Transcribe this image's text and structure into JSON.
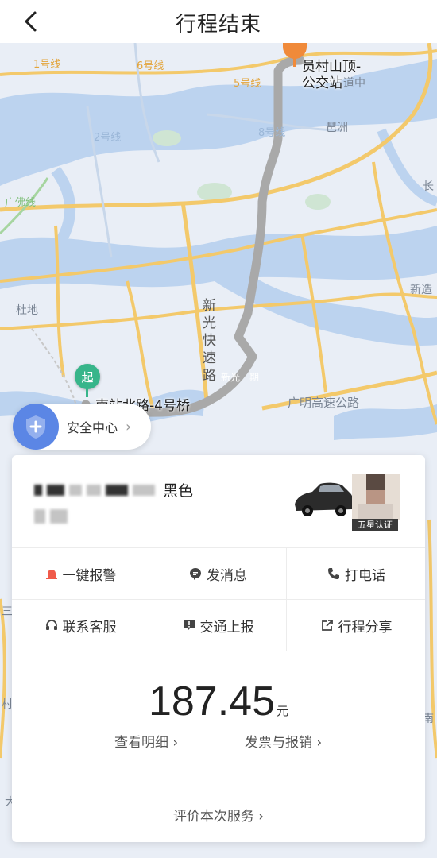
{
  "header": {
    "title": "行程结束"
  },
  "map": {
    "labels": {
      "line1": "1号线",
      "line2": "2号线",
      "line5": "5号线",
      "line6": "6号线",
      "line8": "8号线",
      "guangfo": "广佛线",
      "pazhou": "琶洲",
      "dudi": "杜地",
      "xinzao": "新造",
      "chang": "长",
      "highway": "广明高速公路",
      "xinguang": "新光快速路",
      "fast": "快速",
      "road_zhong": "道中",
      "xinguang_small": "新光一期",
      "san": "三",
      "cun": "村",
      "nan": "南",
      "da": "大"
    },
    "start": {
      "pin": "起",
      "label": "南站北路-4号桥"
    },
    "end": {
      "label_line1": "员村山顶-",
      "label_line2": "公交站"
    }
  },
  "safety": {
    "label": "安全中心"
  },
  "driver": {
    "car_color": "黑色",
    "badge": "五星认证"
  },
  "actions": {
    "alarm": "一键报警",
    "message": "发消息",
    "call": "打电话",
    "service": "联系客服",
    "traffic": "交通上报",
    "share": "行程分享"
  },
  "fare": {
    "amount": "187.45",
    "unit": "元",
    "detail": "查看明细 ›",
    "invoice": "发票与报销 ›"
  },
  "rate": {
    "label": "评价本次服务 ›"
  }
}
